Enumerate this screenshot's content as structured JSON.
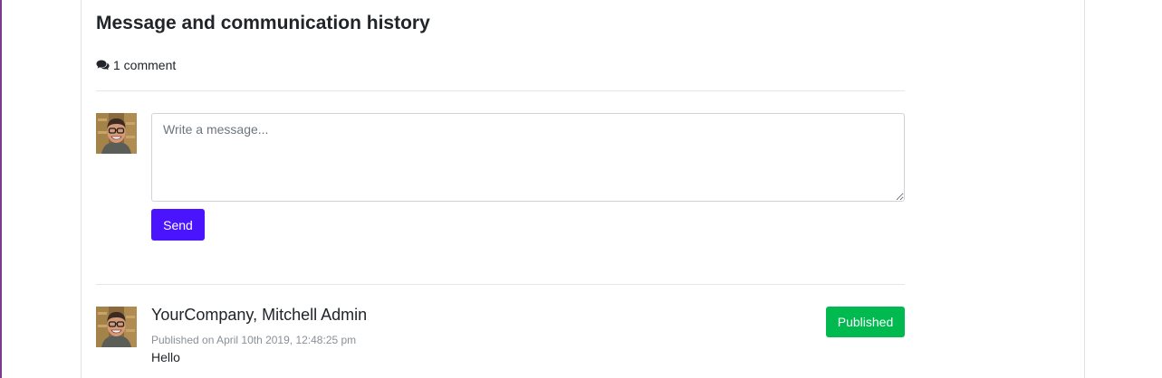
{
  "section": {
    "title": "Message and communication history",
    "comment_count": "1 comment",
    "comment_icon": "comments-icon"
  },
  "composer": {
    "placeholder": "Write a message...",
    "value": "",
    "send_label": "Send",
    "avatar": "user-avatar"
  },
  "messages": [
    {
      "author": "YourCompany, Mitchell Admin",
      "published": "Published on April 10th 2019, 12:48:25 pm",
      "body": "Hello",
      "status": "Published",
      "avatar": "user-avatar"
    }
  ],
  "colors": {
    "send_button": "#4a14ff",
    "status_published": "#00b94f",
    "left_accent": "#7c3a8c"
  }
}
